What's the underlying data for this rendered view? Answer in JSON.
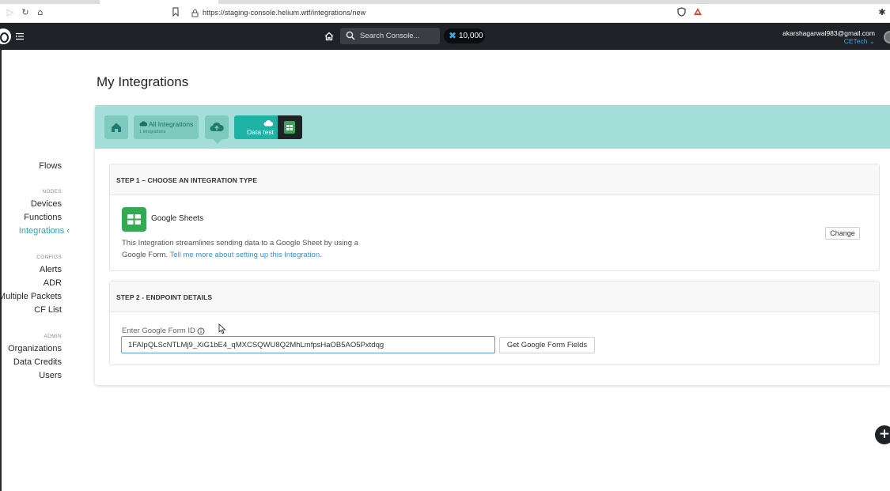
{
  "browser": {
    "url": "https://staging-console.helium.wtf/integrations/new"
  },
  "header": {
    "search_placeholder": "Search Console...",
    "credits": "10,000",
    "user_email": "akarshagarwal983@gmail.com",
    "org_name": "CETech"
  },
  "sidebar": {
    "flows": "Flows",
    "nodes_section": "NODES",
    "devices": "Devices",
    "functions": "Functions",
    "integrations": "Integrations",
    "configs_section": "CONFIGS",
    "alerts": "Alerts",
    "adr": "ADR",
    "multiple_packets": "Multiple Packets",
    "cf_list": "CF List",
    "admin_section": "ADMIN",
    "organizations": "Organizations",
    "data_credits": "Data Credits",
    "users": "Users"
  },
  "page": {
    "title": "My Integrations"
  },
  "breadcrumb": {
    "all_integrations": "All Integrations",
    "integrations_count": "1 Integrations",
    "current": "Data test"
  },
  "step1": {
    "title": "STEP 1 – CHOOSE AN INTEGRATION TYPE",
    "integration_name": "Google Sheets",
    "description": "This Integration streamlines sending data to a Google Sheet by using a Google Form.",
    "link_text": "Tell me more about setting up this Integration.",
    "change_label": "Change"
  },
  "step2": {
    "title": "STEP 2 - ENDPOINT DETAILS",
    "field_label": "Enter Google Form ID",
    "field_value": "1FAIpQLScNTLMj9_XiG1bE4_qMXCSQWU8Q2MhLmfpsHaOB5AO5Pxtdqg",
    "button_label": "Get Google Form Fields"
  },
  "colors": {
    "accent": "#26a8b5",
    "breadcrumb_bg": "#a4e0d9",
    "header_bg": "#1f2227",
    "sheets_green": "#34a853"
  }
}
